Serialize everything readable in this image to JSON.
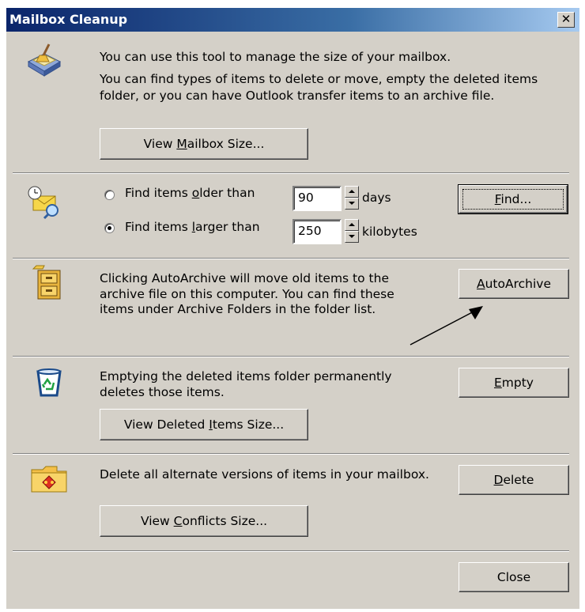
{
  "window": {
    "title": "Mailbox Cleanup",
    "close_glyph": "✕"
  },
  "intro": {
    "line1": "You can use this tool to manage the size of your mailbox.",
    "line2": "You can find types of items to delete or move, empty the deleted items folder, or you can have Outlook transfer items to an archive file.",
    "view_mailbox_size": {
      "pre": "View ",
      "key": "M",
      "post": "ailbox Size..."
    }
  },
  "find": {
    "older": {
      "pre": "Find items ",
      "key": "o",
      "post": "lder than",
      "value": "90",
      "unit": "days",
      "checked": false
    },
    "larger": {
      "pre": "Find items ",
      "key": "l",
      "post": "arger than",
      "value": "250",
      "unit": "kilobytes",
      "checked": true
    },
    "find_button": {
      "key": "F",
      "post": "ind..."
    }
  },
  "autoarchive": {
    "text": "Clicking AutoArchive will move old items to the archive file on this computer.  You can find these items under Archive Folders in the folder list.",
    "button": {
      "key": "A",
      "post": "utoArchive"
    }
  },
  "deleted": {
    "text": "Emptying the deleted items folder permanently deletes those items.",
    "view_button": {
      "pre": "View Deleted ",
      "key": "I",
      "post": "tems Size..."
    },
    "empty_button": {
      "key": "E",
      "post": "mpty"
    }
  },
  "conflicts": {
    "text": "Delete all alternate versions of items in your mailbox.",
    "view_button": {
      "pre": "View ",
      "key": "C",
      "post": "onflicts Size..."
    },
    "delete_button": {
      "key": "D",
      "post": "elete"
    }
  },
  "footer": {
    "close_label": "Close"
  },
  "icons": [
    "mailbox-cleanup-icon",
    "find-items-icon",
    "archive-cabinet-icon",
    "recycle-bin-icon",
    "conflicts-folder-icon"
  ],
  "colors": {
    "title_start": "#0a246a",
    "title_end": "#a6caf0",
    "face": "#d4d0c8"
  }
}
